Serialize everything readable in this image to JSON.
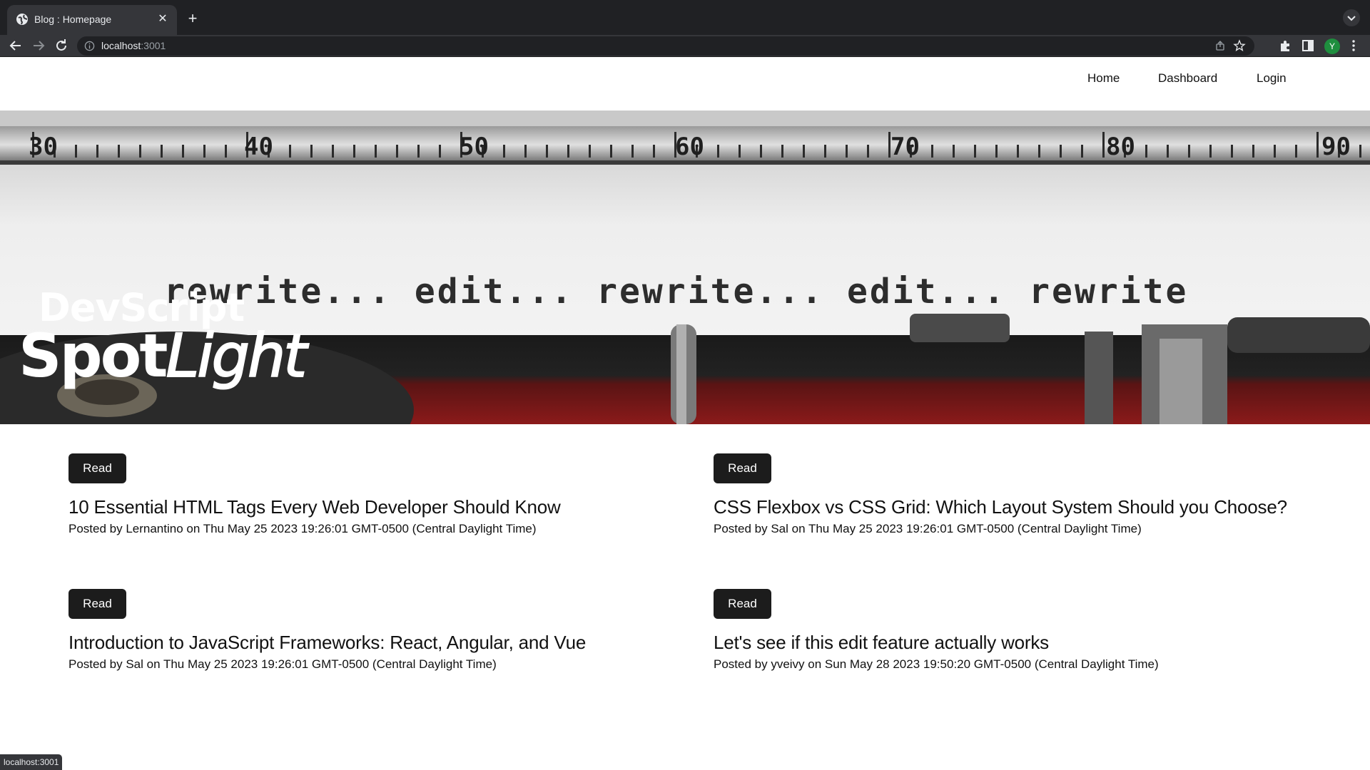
{
  "browser": {
    "tab_title": "Blog : Homepage",
    "url_host": "localhost",
    "url_port": ":3001",
    "avatar_initial": "Y",
    "status_url": "localhost:3001"
  },
  "nav": {
    "home": "Home",
    "dashboard": "Dashboard",
    "login": "Login"
  },
  "hero": {
    "brand_top": "DevScript",
    "brand_spot": "Spot",
    "brand_light": "Light",
    "typed_text": "rewrite... edit... rewrite... edit... rewrite",
    "ruler_numbers": [
      "30",
      "40",
      "50",
      "60",
      "70",
      "80",
      "90"
    ]
  },
  "posts": [
    {
      "read_label": "Read",
      "title": "10 Essential HTML Tags Every Web Developer Should Know",
      "meta": "Posted by Lernantino on Thu May 25 2023 19:26:01 GMT-0500 (Central Daylight Time)"
    },
    {
      "read_label": "Read",
      "title": "CSS Flexbox vs CSS Grid: Which Layout System Should you Choose?",
      "meta": "Posted by Sal on Thu May 25 2023 19:26:01 GMT-0500 (Central Daylight Time)"
    },
    {
      "read_label": "Read",
      "title": "Introduction to JavaScript Frameworks: React, Angular, and Vue",
      "meta": "Posted by Sal on Thu May 25 2023 19:26:01 GMT-0500 (Central Daylight Time)"
    },
    {
      "read_label": "Read",
      "title": "Let's see if this edit feature actually works",
      "meta": "Posted by yveivy on Sun May 28 2023 19:50:20 GMT-0500 (Central Daylight Time)"
    }
  ],
  "colors": {
    "chrome_dark": "#202124",
    "chrome_toolbar": "#35363a",
    "button_bg": "#1c1c1c",
    "typewriter_red": "#8b1a1a"
  }
}
